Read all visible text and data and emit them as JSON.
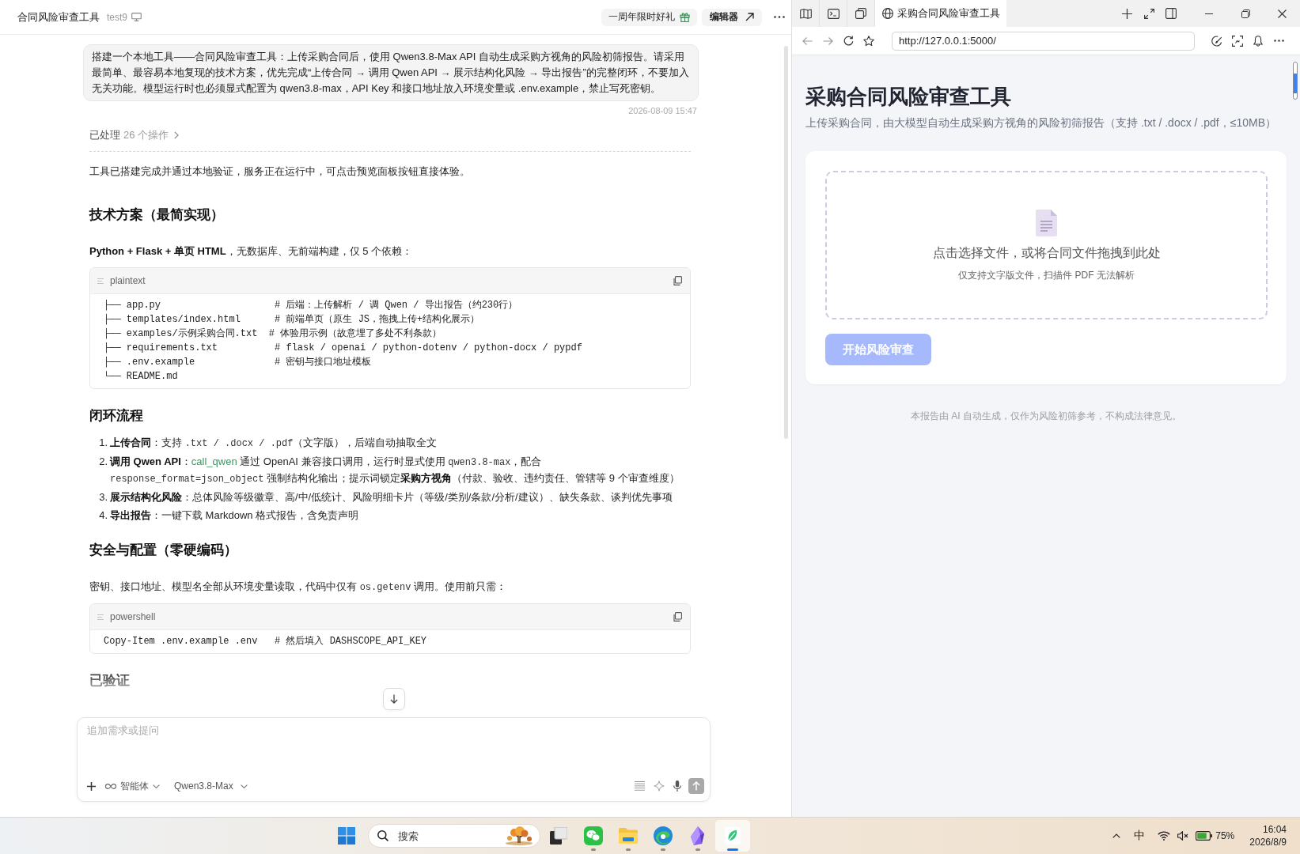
{
  "chat_pane": {
    "header": {
      "title": "合同风险审查工具",
      "project": "test9",
      "promo": "一周年限时好礼",
      "editor_button": "编辑器"
    },
    "user_message": {
      "text": "搭建一个本地工具——合同风险审查工具：上传采购合同后，使用 Qwen3.8-Max API 自动生成采购方视角的风险初筛报告。请采用最简单、最容易本地复现的技术方案，优先完成“上传合同 → 调用 Qwen API → 展示结构化风险 → 导出报告”的完整闭环，不要加入无关功能。模型运行时也必须显式配置为 qwen3.8-max，API Key 和接口地址放入环境变量或 .env.example，禁止写死密钥。",
      "time": "2026-08-09 15:47"
    },
    "activity": {
      "label": "已处理",
      "count": "26 个操作",
      "expanded": false
    },
    "blocks": [
      {
        "kind": "paragraph",
        "segments": [
          {
            "kind": "text",
            "text": "工具已搭建完成并通过本地验证，服务正在运行中，可点击预览面板按钮直接体验。"
          }
        ]
      },
      {
        "kind": "heading",
        "text": "技术方案（最简实现）"
      },
      {
        "kind": "paragraph",
        "segments": [
          {
            "kind": "bold",
            "text": "Python + Flask + 单页 HTML"
          },
          {
            "kind": "text",
            "text": "，无数据库、无前端构建，仅 5 个依赖："
          }
        ]
      },
      {
        "kind": "code",
        "language": "plaintext",
        "lines": [
          "├── app.py                    # 后端：上传解析 / 调 Qwen / 导出报告（约230行）",
          "├── templates/index.html      # 前端单页（原生 JS，拖拽上传+结构化展示）",
          "├── examples/示例采购合同.txt  # 体验用示例（故意埋了多处不利条款）",
          "├── requirements.txt          # flask / openai / python-dotenv / python-docx / pypdf",
          "├── .env.example              # 密钥与接口地址模板",
          "└── README.md"
        ]
      },
      {
        "kind": "heading",
        "text": "闭环流程"
      },
      {
        "kind": "list",
        "items": [
          {
            "marker": "1.",
            "segments": [
              {
                "kind": "bold",
                "text": "上传合同"
              },
              {
                "kind": "text",
                "text": "：支持 "
              },
              {
                "kind": "code",
                "text": ".txt / .docx / .pdf"
              },
              {
                "kind": "text",
                "text": "（文字版），后端自动抽取全文"
              }
            ]
          },
          {
            "marker": "2.",
            "segments": [
              {
                "kind": "bold",
                "text": "调用 Qwen API"
              },
              {
                "kind": "text",
                "text": "："
              },
              {
                "kind": "link",
                "text": "call_qwen"
              },
              {
                "kind": "text",
                "text": " 通过 OpenAI 兼容接口调用，运行时显式使用 "
              },
              {
                "kind": "code",
                "text": "qwen3.8-max"
              },
              {
                "kind": "text",
                "text": "，配合 "
              },
              {
                "kind": "code",
                "text": "response_format=json_object"
              },
              {
                "kind": "text",
                "text": " 强制结构化输出；提示词锁定"
              },
              {
                "kind": "bold",
                "text": "采购方视角"
              },
              {
                "kind": "text",
                "text": "（付款、验收、违约责任、管辖等 9 个审查维度）"
              }
            ]
          },
          {
            "marker": "3.",
            "segments": [
              {
                "kind": "bold",
                "text": "展示结构化风险"
              },
              {
                "kind": "text",
                "text": "：总体风险等级徽章、高/中/低统计、风险明细卡片（等级/类别/条款/分析/建议）、缺失条款、谈判优先事项"
              }
            ]
          },
          {
            "marker": "4.",
            "segments": [
              {
                "kind": "bold",
                "text": "导出报告"
              },
              {
                "kind": "text",
                "text": "：一键下载 Markdown 格式报告，含免责声明"
              }
            ]
          }
        ]
      },
      {
        "kind": "heading",
        "text": "安全与配置（零硬编码）"
      },
      {
        "kind": "paragraph",
        "segments": [
          {
            "kind": "text",
            "text": "密钥、接口地址、模型名全部从环境变量读取，代码中仅有 "
          },
          {
            "kind": "code",
            "text": "os.getenv"
          },
          {
            "kind": "text",
            "text": " 调用。使用前只需："
          }
        ]
      },
      {
        "kind": "code",
        "language": "powershell",
        "lines": [
          "Copy-Item .env.example .env   # 然后填入 DASHSCOPE_API_KEY"
        ]
      },
      {
        "kind": "heading",
        "text": "已验证"
      }
    ],
    "composer": {
      "placeholder": "追加需求或提问",
      "agent_mode": "智能体",
      "model": "Qwen3.8-Max"
    }
  },
  "browser": {
    "tabs": [
      {
        "title": "采购合同风险审查工具",
        "selected": true
      }
    ],
    "url": "http://127.0.0.1:5000/",
    "page": {
      "title": "采购合同风险审查工具",
      "subtitle": "上传采购合同，由大模型自动生成采购方视角的风险初筛报告（支持 .txt / .docx / .pdf，≤10MB）",
      "upload": {
        "prompt": "点击选择文件，或将合同文件拖拽到此处",
        "hint": "仅支持文字版文件，扫描件 PDF 无法解析"
      },
      "submit_button": {
        "label": "开始风险审查",
        "disabled": true
      },
      "disclaimer": "本报告由 AI 自动生成，仅作为风险初筛参考，不构成法律意见。"
    }
  },
  "taskbar": {
    "search": {
      "placeholder": "搜索"
    },
    "apps": [
      {
        "running": false,
        "selected": false
      },
      {
        "running": true,
        "selected": false
      },
      {
        "running": true,
        "selected": false
      },
      {
        "running": true,
        "selected": false
      },
      {
        "running": true,
        "selected": false
      },
      {
        "running": true,
        "selected": true
      }
    ],
    "ime": "中",
    "battery": "75%",
    "time": "16:04",
    "date": "2026/8/9"
  }
}
